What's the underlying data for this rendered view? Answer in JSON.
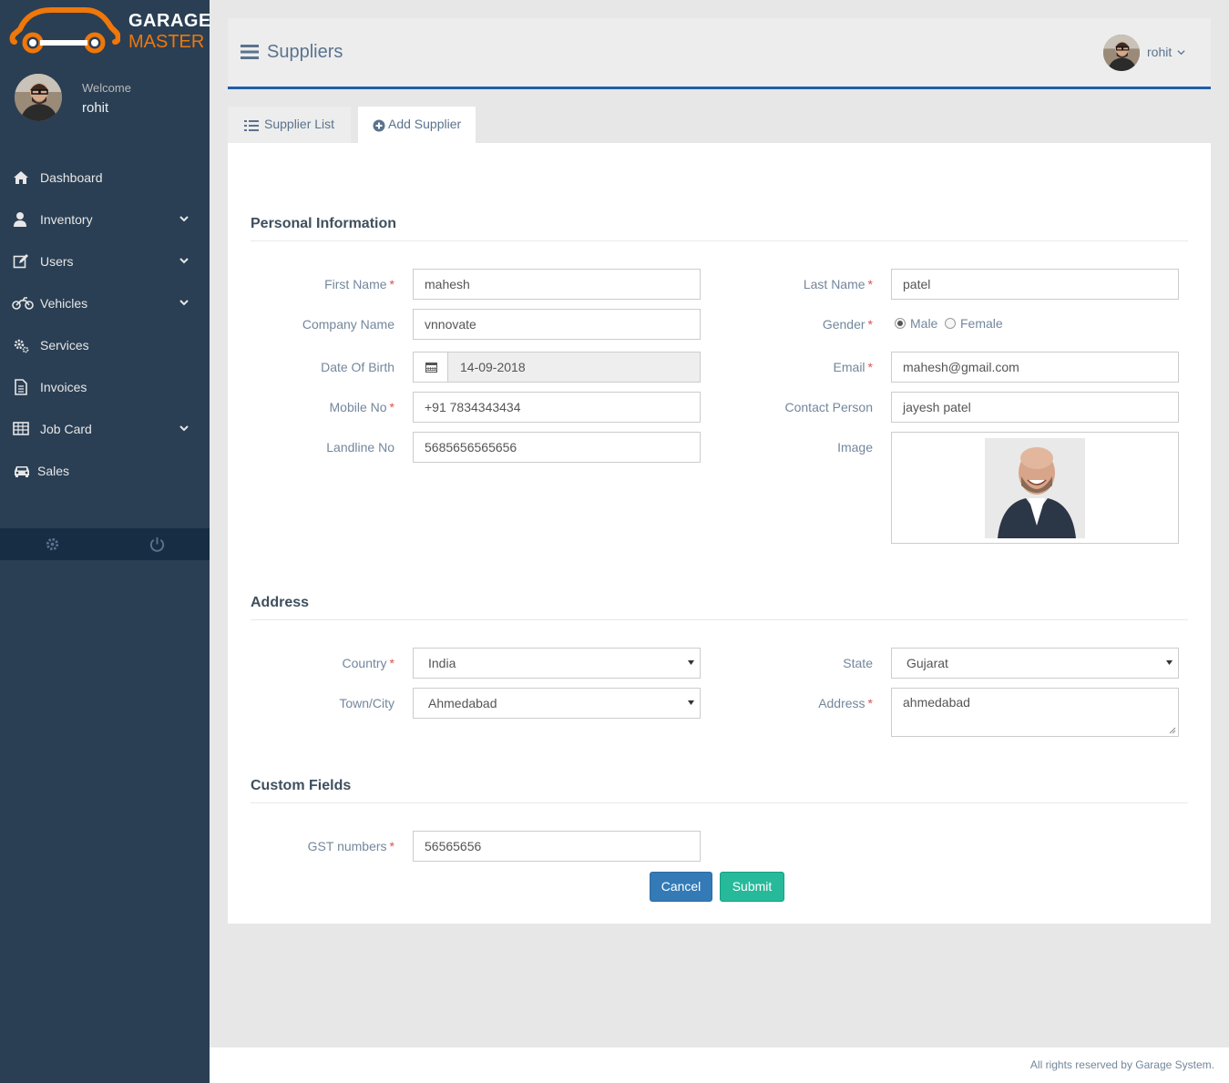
{
  "app": {
    "logo_line1": "GARAGE",
    "logo_line2": "MASTER",
    "logo_color": "#f0770a"
  },
  "sidebar": {
    "welcome": "Welcome",
    "username": "rohit",
    "items": [
      {
        "label": "Dashboard",
        "icon": "home-icon",
        "has_submenu": false
      },
      {
        "label": "Inventory",
        "icon": "user-icon",
        "has_submenu": true
      },
      {
        "label": "Users",
        "icon": "edit-icon",
        "has_submenu": true
      },
      {
        "label": "Vehicles",
        "icon": "motorcycle-icon",
        "has_submenu": true
      },
      {
        "label": "Services",
        "icon": "gears-icon",
        "has_submenu": false
      },
      {
        "label": "Invoices",
        "icon": "document-icon",
        "has_submenu": false
      },
      {
        "label": "Job Card",
        "icon": "table-icon",
        "has_submenu": true
      },
      {
        "label": "Sales",
        "icon": "taxi-icon",
        "has_submenu": false
      }
    ],
    "footer_icons": [
      "settings-icon",
      "power-icon"
    ],
    "bg_color": "#2a3f54"
  },
  "header": {
    "title": "Suppliers",
    "user_name": "rohit"
  },
  "tabs": [
    {
      "label": "Supplier List",
      "icon": "list-icon",
      "active": false
    },
    {
      "label": "Add Supplier",
      "icon": "plus-circle-icon",
      "active": true
    }
  ],
  "form": {
    "section_personal": "Personal Information",
    "section_address": "Address",
    "section_custom": "Custom Fields",
    "first_name": {
      "label": "First Name",
      "value": "mahesh",
      "required": true
    },
    "last_name": {
      "label": "Last Name",
      "value": "patel",
      "required": true
    },
    "company_name": {
      "label": "Company Name",
      "value": "vnnovate",
      "required": false
    },
    "gender": {
      "label": "Gender",
      "required": true,
      "options": [
        "Male",
        "Female"
      ],
      "selected": "Male"
    },
    "dob": {
      "label": "Date Of Birth",
      "value": "14-09-2018",
      "required": false
    },
    "email": {
      "label": "Email",
      "value": "mahesh@gmail.com",
      "required": true
    },
    "mobile": {
      "label": "Mobile No",
      "value": "+91 7834343434",
      "required": true
    },
    "contact_person": {
      "label": "Contact Person",
      "value": "jayesh patel",
      "required": false
    },
    "landline": {
      "label": "Landline No",
      "value": "5685656565656",
      "required": false
    },
    "image": {
      "label": "Image"
    },
    "country": {
      "label": "Country",
      "value": "India",
      "required": true
    },
    "state": {
      "label": "State",
      "value": "Gujarat",
      "required": false
    },
    "town": {
      "label": "Town/City",
      "value": "Ahmedabad",
      "required": false
    },
    "address": {
      "label": "Address",
      "value": "ahmedabad",
      "required": true
    },
    "gst": {
      "label": "GST numbers",
      "value": "56565656",
      "required": true
    },
    "required_mark": "*",
    "cancel_label": "Cancel",
    "submit_label": "Submit"
  },
  "footer": {
    "text": "All rights reserved by Garage System."
  },
  "colors": {
    "accent": "#1f5fa8",
    "primary_button": "#337ab7",
    "success_button": "#26b99a",
    "required": "#d9534f"
  }
}
